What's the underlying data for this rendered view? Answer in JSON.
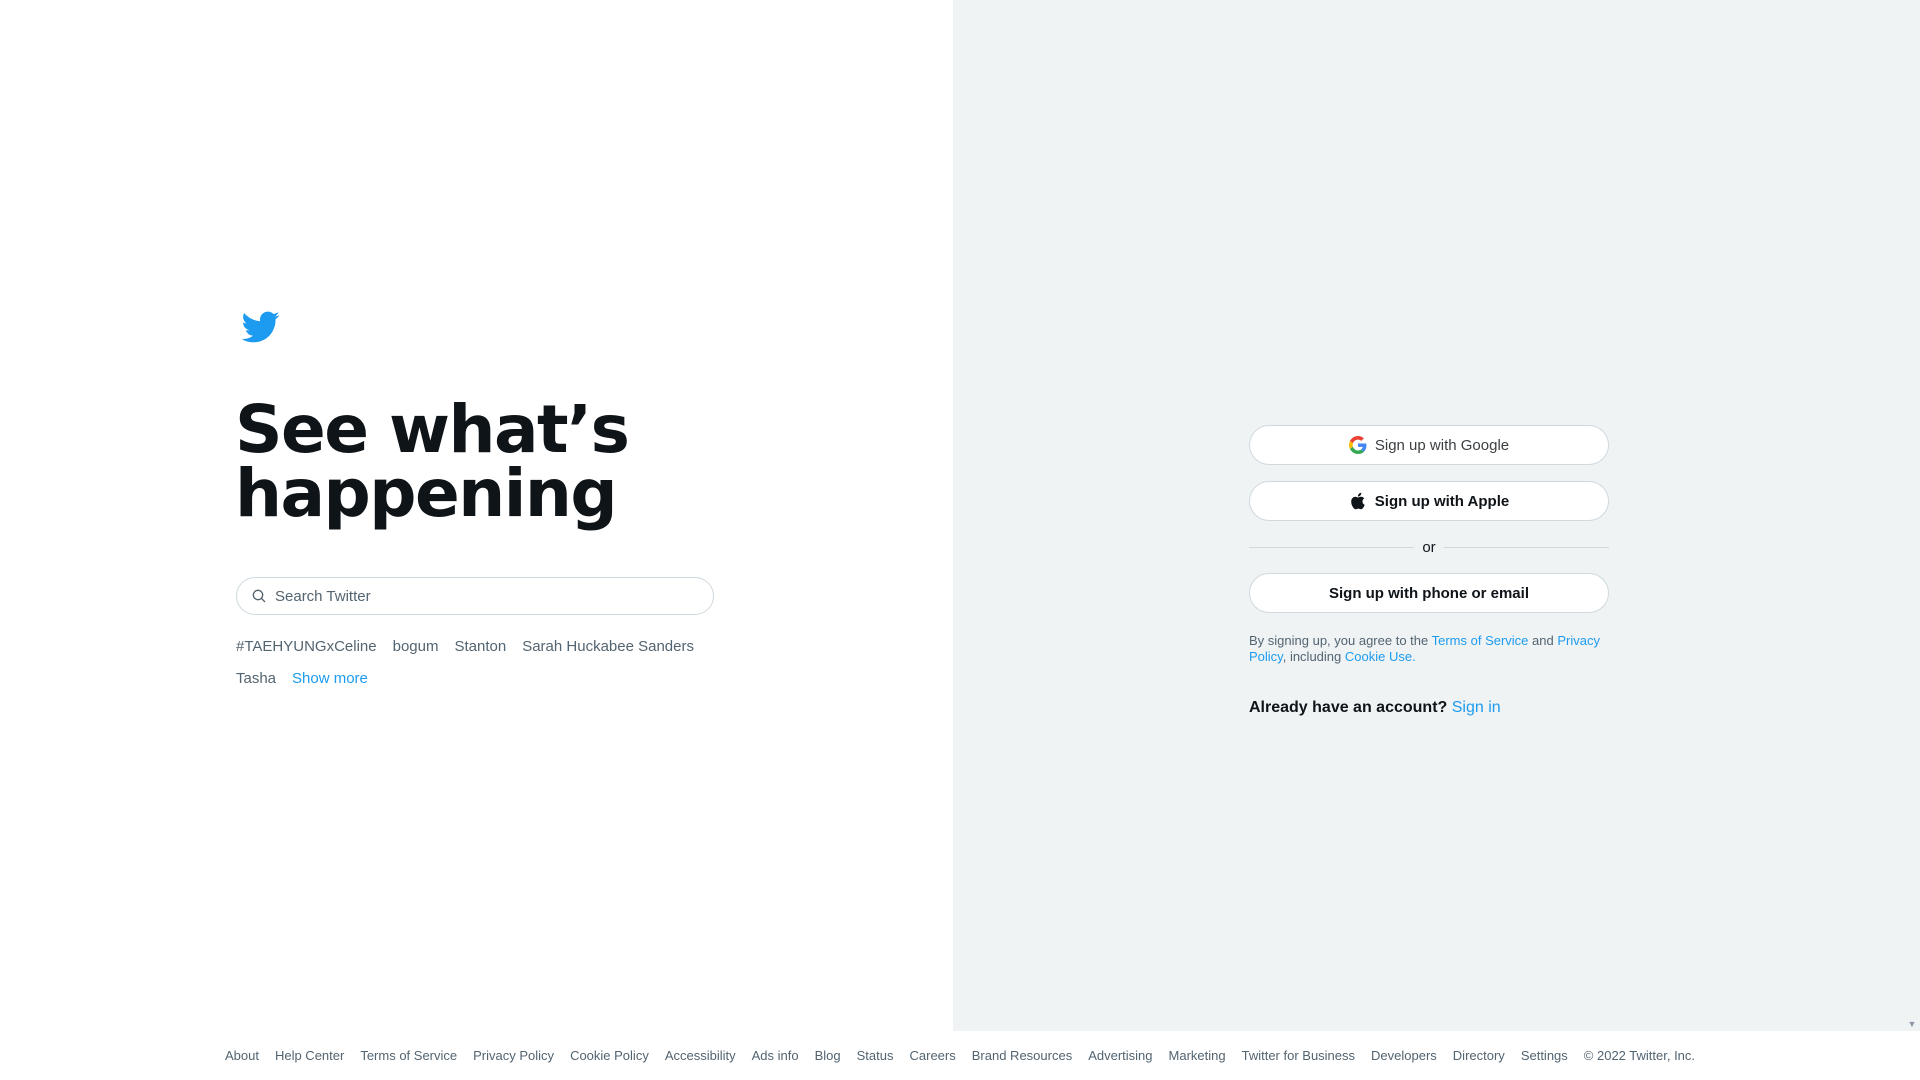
{
  "brand": {
    "logo_icon": "twitter-bird-icon",
    "accent_color": "#1d9bf0"
  },
  "hero": {
    "headline_line1": "See what’s",
    "headline_line2": "happening"
  },
  "search": {
    "icon": "search-icon",
    "placeholder": "Search Twitter",
    "value": ""
  },
  "trends": {
    "items": [
      "#TAEHYUNGxCeline",
      "bogum",
      "Stanton",
      "Sarah Huckabee Sanders",
      "Tasha"
    ],
    "show_more": "Show more"
  },
  "signup": {
    "google_label": "Sign up with Google",
    "google_icon": "google-icon",
    "apple_label": "Sign up with Apple",
    "apple_icon": "apple-icon",
    "divider_text": "or",
    "phone_email_label": "Sign up with phone or email",
    "legal": {
      "prefix": "By signing up, you agree to the ",
      "terms_link": "Terms of Service",
      "and": " and ",
      "privacy_link": "Privacy Policy",
      "including": ", including ",
      "cookie_link": "Cookie Use."
    },
    "have_account_text": "Already have an account?",
    "sign_in_link": "Sign in"
  },
  "footer": {
    "links": [
      "About",
      "Help Center",
      "Terms of Service",
      "Privacy Policy",
      "Cookie Policy",
      "Accessibility",
      "Ads info",
      "Blog",
      "Status",
      "Careers",
      "Brand Resources",
      "Advertising",
      "Marketing",
      "Twitter for Business",
      "Developers",
      "Directory",
      "Settings"
    ],
    "copyright": "© 2022 Twitter, Inc."
  }
}
